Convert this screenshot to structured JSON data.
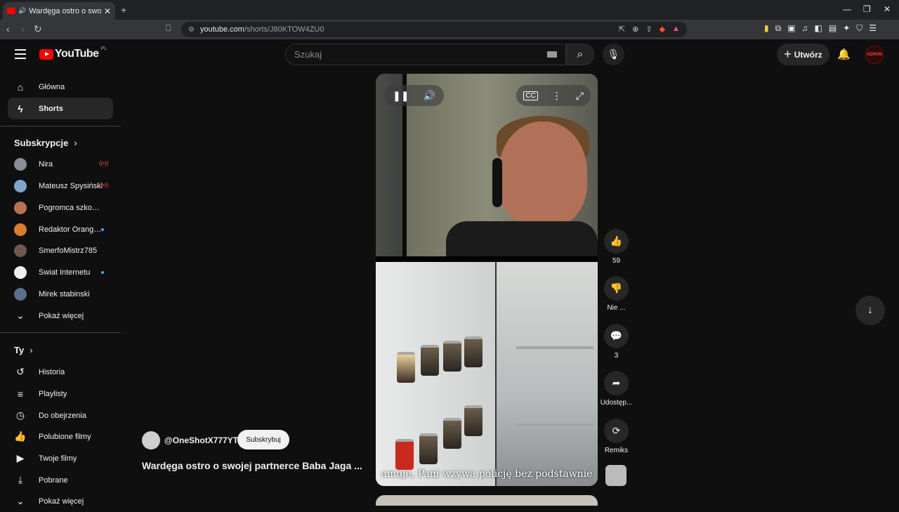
{
  "browser": {
    "tab_title": "Wardęga ostro o swojej partnerce",
    "new_tab_symbol": "+",
    "url_host": "youtube.com",
    "url_path": "/shorts/J80KTOW4ZU0",
    "window_controls": [
      "—",
      "❐",
      "✕"
    ]
  },
  "header": {
    "logo_text": "YouTube",
    "region": "PL",
    "search_placeholder": "Szukaj",
    "create_label": "Utwórz",
    "avatar_text": "ADRON"
  },
  "sidebar": {
    "main": [
      {
        "label": "Główna",
        "icon": "home-icon"
      },
      {
        "label": "Shorts",
        "icon": "shorts-icon",
        "active": true
      }
    ],
    "subscriptions_heading": "Subskrypcje",
    "subscriptions": [
      {
        "label": "Nira",
        "status": "live"
      },
      {
        "label": "Mateusz Spysiński",
        "status": "live"
      },
      {
        "label": "Pogromca szkodnikó",
        "status": ""
      },
      {
        "label": "Redaktor Orangutan",
        "status": "new"
      },
      {
        "label": "SmerfoMistrz785",
        "status": ""
      },
      {
        "label": "Świat Internetu",
        "status": "new"
      },
      {
        "label": "Mirek stabinski",
        "status": ""
      }
    ],
    "show_more": "Pokaż więcej",
    "you_heading": "Ty",
    "you_items": [
      {
        "label": "Historia",
        "icon": "history-icon"
      },
      {
        "label": "Playlisty",
        "icon": "playlist-icon"
      },
      {
        "label": "Do obejrzenia",
        "icon": "clock-icon"
      },
      {
        "label": "Polubione filmy",
        "icon": "like-icon"
      },
      {
        "label": "Twoje filmy",
        "icon": "video-icon"
      },
      {
        "label": "Pobrane",
        "icon": "download-icon"
      },
      {
        "label": "Pokaż więcej",
        "icon": "chevron-down-icon"
      }
    ]
  },
  "short": {
    "subtitle": "amuje, Pani wzywa policję bez podstawnie",
    "channel": "@OneShotX777YT",
    "subscribe_label": "Subskrybuj",
    "title": "Wardęga ostro o swojej partnerce Baba Jaga ...",
    "likes": "59",
    "dislike_label": "Nie ...",
    "comments": "3",
    "share_label": "Udostęp...",
    "remix_label": "Remiks"
  }
}
